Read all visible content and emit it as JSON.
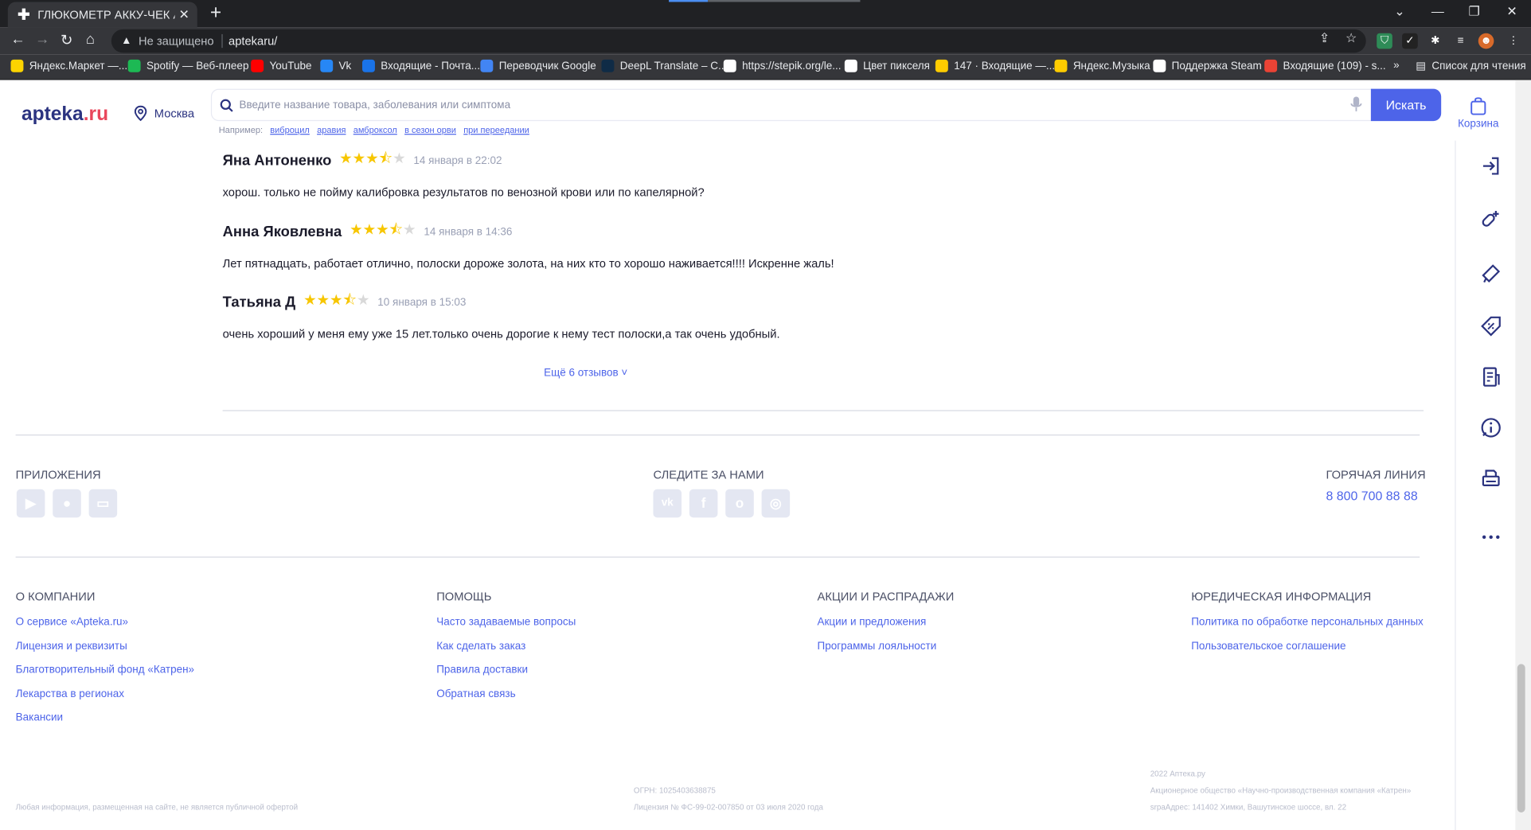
{
  "browser": {
    "tab_title": "ГЛЮКОМЕТР АККУ-ЧЕК АКТИВ",
    "not_secure": "Не защищено",
    "url": "aptekaru/",
    "bookmarks": [
      {
        "label": "Яндекс.Маркет —...",
        "color": "#fcd400"
      },
      {
        "label": "Spotify — Веб-плеер",
        "color": "#1db954"
      },
      {
        "label": "YouTube",
        "color": "#ff0000"
      },
      {
        "label": "Vk",
        "color": "#2787f5"
      },
      {
        "label": "Входящие - Почта...",
        "color": "#1a73e8"
      },
      {
        "label": "Переводчик Google",
        "color": "#4285f4"
      },
      {
        "label": "DeepL Translate – C...",
        "color": "#0f2b46"
      },
      {
        "label": "https://stepik.org/le...",
        "color": "#ffffff"
      },
      {
        "label": "Цвет пикселя",
        "color": "#ffffff"
      },
      {
        "label": "147 · Входящие —...",
        "color": "#ffcc00"
      },
      {
        "label": "Яндекс.Музыка",
        "color": "#ffcc00"
      },
      {
        "label": "Поддержка Steam",
        "color": "#ffffff"
      },
      {
        "label": "Входящие (109) - s...",
        "color": "#ea4335"
      }
    ],
    "more_bookmarks": "»",
    "reading_list": "Список для чтения"
  },
  "header": {
    "logo_main": "apteka",
    "logo_suffix": ".ru",
    "city": "Москва",
    "search_placeholder": "Введите название товара, заболевания или симптома",
    "search_button": "Искать",
    "examples_label": "Например:",
    "examples": [
      "виброцил",
      "аравия",
      "амброксол",
      "в сезон орви",
      "при переедании"
    ],
    "cart_label": "Корзина"
  },
  "reviews": [
    {
      "name": "Яна Антоненко",
      "stars": "★★★⯪",
      "empty": "★",
      "date": "14 января в 22:02",
      "text": "хорош. только не пойму калибровка результатов по венозной крови или по капелярной?"
    },
    {
      "name": "Анна Яковлевна",
      "stars": "★★★⯪",
      "empty": "★",
      "date": "14 января в 14:36",
      "text": "Лет пятнадцать, работает отлично, полоски дороже золота, на них кто то хорошо наживается!!!! Искренне жаль!"
    },
    {
      "name": "Татьяна Д",
      "stars": "★★★⯪",
      "empty": "★",
      "date": "10 января в 15:03",
      "text": "очень хороший у меня ему уже 15 лет.только очень дорогие к нему тест полоски,а так очень удобный."
    }
  ],
  "more_reviews": "Ещё 6 отзывов ˅",
  "footer": {
    "apps_title": "ПРИЛОЖЕНИЯ",
    "follow_title": "СЛЕДИТЕ ЗА НАМИ",
    "hotline_title": "ГОРЯЧАЯ ЛИНИЯ",
    "hotline_phone": "8 800 700 88 88",
    "company_title": "О КОМПАНИИ",
    "company_links": [
      "О сервисе «Apteka.ru»",
      "Лицензия и реквизиты",
      "Благотворительный фонд «Катрен»",
      "Лекарства в регионах",
      "Вакансии"
    ],
    "help_title": "ПОМОЩЬ",
    "help_links": [
      "Часто задаваемые вопросы",
      "Как сделать заказ",
      "Правила доставки",
      "Обратная связь"
    ],
    "promo_title": "АКЦИИ И РАСПРАДАЖИ",
    "promo_links": [
      "Акции и предложения",
      "Программы лояльности"
    ],
    "legal_title": "ЮРЕДИЧЕСКАЯ ИНФОРМАЦИЯ",
    "legal_links": [
      "Политика по обработке персональных данных",
      "Пользовательское соглашение"
    ],
    "disclaimer": "Любая информация, размещенная на сайте, не является публичной офертой",
    "ogrn": "ОГРН: 1025403638875",
    "license": "Лицензия № ФС-99-02-007850 от 03 июля 2020 года",
    "copyright": "2022 Аптека.ру",
    "company_full": "Акционерное общество «Научно-производственная компания «Катрен»",
    "address": "srpaАдрес: 141402 Химки, Вашутинское шоссе, вл. 22"
  }
}
